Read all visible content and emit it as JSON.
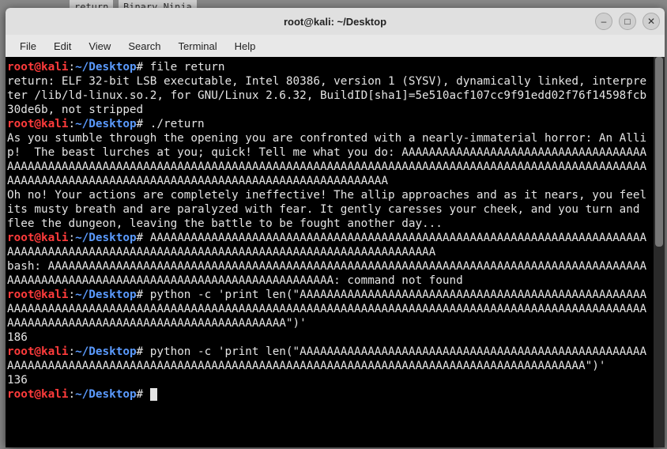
{
  "window": {
    "title": "root@kali: ~/Desktop"
  },
  "menubar": {
    "items": [
      "File",
      "Edit",
      "View",
      "Search",
      "Terminal",
      "Help"
    ]
  },
  "prompt": {
    "user": "root@kali",
    "colon_pre": ":",
    "path": "~/Desktop",
    "hash": "#"
  },
  "terminal": {
    "commands": {
      "c1": "file return",
      "c2": "./return",
      "c3": "AAAAAAAAAAAAAAAAAAAAAAAAAAAAAAAAAAAAAAAAAAAAAAAAAAAAAAAAAAAAAAAAAAAAAAAAAAAAAAAAAAAAAAAAAAAAAAAAAAAAAAAAAAAAAAAAAAAAAAAAAAAAAAAAAAAAAAAA",
      "c4": "python -c 'print len(\"AAAAAAAAAAAAAAAAAAAAAAAAAAAAAAAAAAAAAAAAAAAAAAAAAAAAAAAAAAAAAAAAAAAAAAAAAAAAAAAAAAAAAAAAAAAAAAAAAAAAAAAAAAAAAAAAAAAAAAAAAAAAAAAAAAAAAAAAAAAAAAAAAAAAAAAAAAAAAAAAAAAAAAAAAAAAAAAAAAAAAAAAAA\")'",
      "c5": "python -c 'print len(\"AAAAAAAAAAAAAAAAAAAAAAAAAAAAAAAAAAAAAAAAAAAAAAAAAAAAAAAAAAAAAAAAAAAAAAAAAAAAAAAAAAAAAAAAAAAAAAAAAAAAAAAAAAAAAAAAAAAAAAAAAAAAAAAAAAAAAAAA\")'"
    },
    "output": {
      "o1": "return: ELF 32-bit LSB executable, Intel 80386, version 1 (SYSV), dynamically linked, interpreter /lib/ld-linux.so.2, for GNU/Linux 2.6.32, BuildID[sha1]=5e510acf107cc9f91edd02f76f14598fcb30de6b, not stripped",
      "o2a": "As you stumble through the opening you are confronted with a nearly-immaterial horror: An Allip!  The beast lurches at you; quick! Tell me what you do: AAAAAAAAAAAAAAAAAAAAAAAAAAAAAAAAAAAAAAAAAAAAAAAAAAAAAAAAAAAAAAAAAAAAAAAAAAAAAAAAAAAAAAAAAAAAAAAAAAAAAAAAAAAAAAAAAAAAAAAAAAAAAAAAAAAAAAAAAAAAAAAAAAAAAAAAAAAAAAAAAAAAAAAAAAAAAAAAAAAAAAAAAA",
      "o2b": "Oh no! Your actions are completely ineffective! The allip approaches and as it nears, you feel its musty breath and are paralyzed with fear. It gently caresses your cheek, and you turn and flee the dungeon, leaving the battle to be fought another day...",
      "o3": "bash: AAAAAAAAAAAAAAAAAAAAAAAAAAAAAAAAAAAAAAAAAAAAAAAAAAAAAAAAAAAAAAAAAAAAAAAAAAAAAAAAAAAAAAAAAAAAAAAAAAAAAAAAAAAAAAAAAAAAAAAAAAAAAAAAAAAAAAAA: command not found",
      "o4": "186",
      "o5": "136"
    }
  },
  "icons": {
    "minimize": "–",
    "maximize": "□",
    "close": "✕"
  },
  "bg": {
    "frag1": "return",
    "frag2": "Binary Ninja"
  }
}
